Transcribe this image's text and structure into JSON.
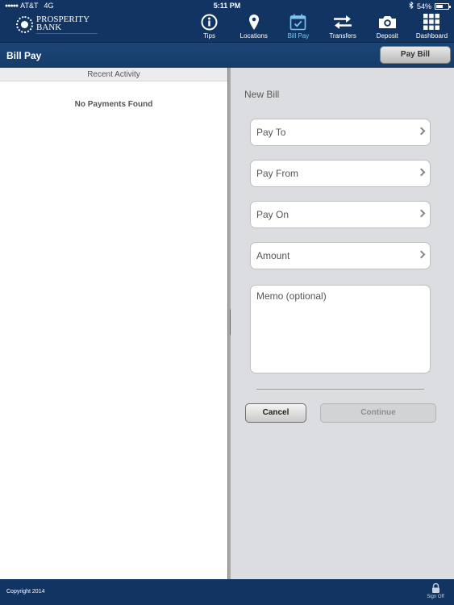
{
  "status_bar": {
    "carrier": "AT&T",
    "network": "4G",
    "time": "5:11 PM",
    "battery": "54%",
    "battery_level": 0.54
  },
  "brand": {
    "line1": "PROSPERITY",
    "line2": "BANK",
    "icon": "prosperity-bank-logo"
  },
  "nav": [
    {
      "label": "Tips",
      "icon": "info-icon"
    },
    {
      "label": "Locations",
      "icon": "location-pin-icon"
    },
    {
      "label": "Bill Pay",
      "icon": "calendar-check-icon",
      "active": true
    },
    {
      "label": "Transfers",
      "icon": "transfer-arrows-icon"
    },
    {
      "label": "Deposit",
      "icon": "camera-icon"
    },
    {
      "label": "Dashboard",
      "icon": "grid-icon"
    }
  ],
  "header": {
    "title": "Bill Pay",
    "pay_bill_button": "Pay Bill"
  },
  "left_panel": {
    "section_title": "Recent Activity",
    "empty_message": "No Payments Found"
  },
  "form": {
    "title": "New Bill",
    "fields": [
      {
        "label": "Pay To"
      },
      {
        "label": "Pay From"
      },
      {
        "label": "Pay On"
      },
      {
        "label": "Amount"
      }
    ],
    "memo_placeholder": "Memo (optional)",
    "cancel_label": "Cancel",
    "continue_label": "Continue"
  },
  "footer": {
    "copyright": "Copyright 2014",
    "sign_off": "Sign Off"
  },
  "colors": {
    "header_navy": "#123462",
    "active_nav": "#7ec4f2",
    "panel_gray": "#dcdde0"
  }
}
